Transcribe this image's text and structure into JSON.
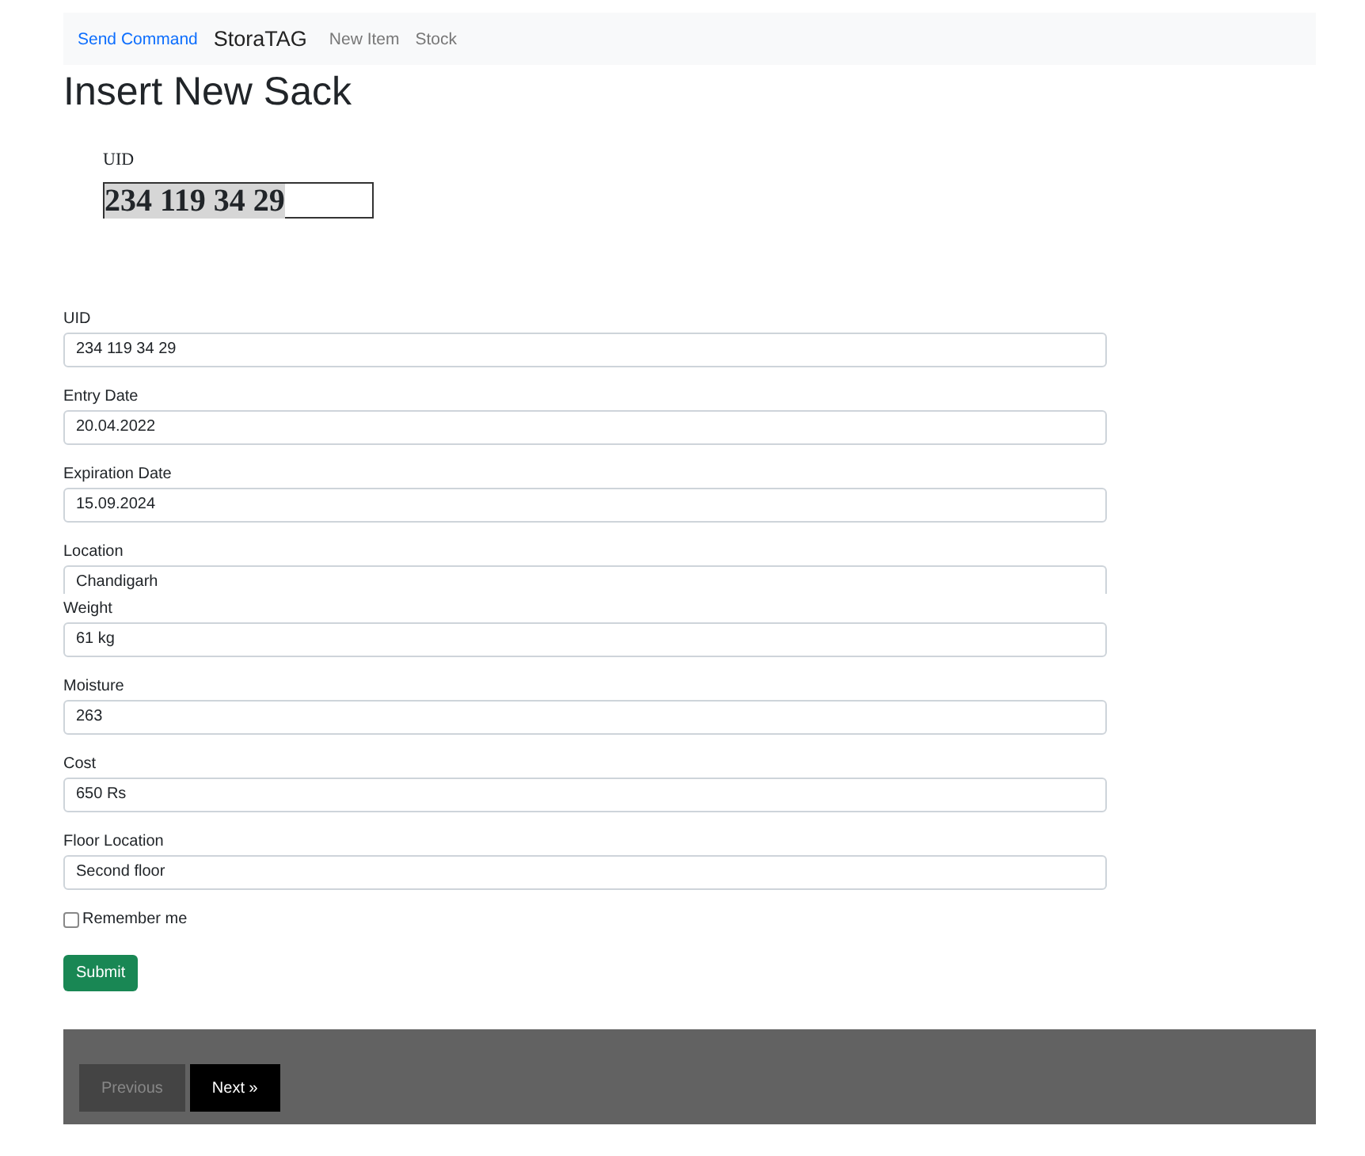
{
  "navbar": {
    "links": [
      {
        "label": "Send Command",
        "kind": "link"
      },
      {
        "label": "StoraTAG",
        "kind": "brand"
      },
      {
        "label": "New Item",
        "kind": "nav"
      },
      {
        "label": "Stock",
        "kind": "nav"
      }
    ]
  },
  "title": "Insert New Sack",
  "scan": {
    "label": "UID",
    "value": "234 119 34 29",
    "highlighted": true
  },
  "fields": [
    {
      "label": "UID",
      "value": "234 119 34 29",
      "kind": "full"
    },
    {
      "label": "Entry Date",
      "value": "20.04.2022",
      "kind": "full"
    },
    {
      "label": "Expiration Date",
      "value": "15.09.2024",
      "kind": "full"
    },
    {
      "label": "Location",
      "value": "Chandigarh",
      "kind": "clipped"
    },
    {
      "label": "Weight",
      "value": "61 kg",
      "kind": "full"
    },
    {
      "label": "Moisture",
      "value": "263",
      "kind": "full"
    },
    {
      "label": "Cost",
      "value": "650 Rs",
      "kind": "full"
    },
    {
      "label": "Floor Location",
      "value": "Second floor",
      "kind": "full"
    }
  ],
  "remember": {
    "label": "Remember me",
    "checked": false
  },
  "submit": "Submit",
  "pager": [
    {
      "label": "Previous",
      "disabled": true
    },
    {
      "label": "Next »",
      "disabled": false
    }
  ]
}
